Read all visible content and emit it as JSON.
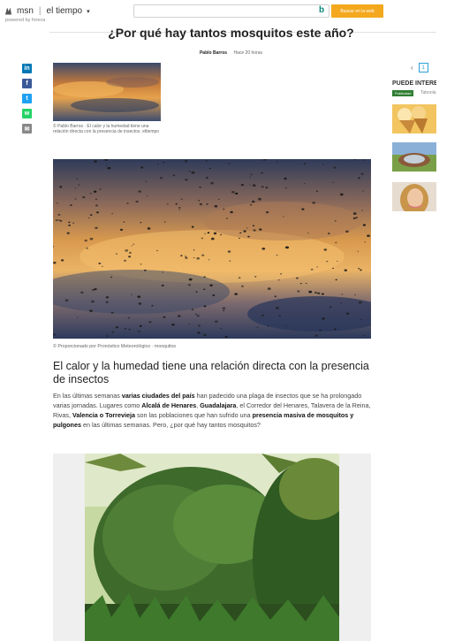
{
  "header": {
    "brand": "msn",
    "section": "el tiempo",
    "powered_by": "powered by foreca",
    "search_placeholder": "",
    "search_button": "Buscar en la web"
  },
  "article": {
    "title": "¿Por qué hay tantos mosquitos este año?",
    "author": "Pablo Barros",
    "time": "Hace 20 horas",
    "hero_caption": "© Pablo Barros · El calor y la humedad tiene una relación directa con la presencia de insectos. eltiempo",
    "main_caption": "© Proporcionado por Pronóstico Meteorológico · mosquitos",
    "subheading": "El calor y la humedad tiene una relación directa con la presencia de insectos",
    "paragraph": [
      {
        "t": "En las últimas semanas ",
        "b": false
      },
      {
        "t": "varias ciudades del país",
        "b": true
      },
      {
        "t": " han padecido una plaga de insectos que se ha prolongado varias jornadas. Lugares como ",
        "b": false
      },
      {
        "t": "Alcalá de Henares",
        "b": true
      },
      {
        "t": ", ",
        "b": false
      },
      {
        "t": "Guadalajara",
        "b": true
      },
      {
        "t": ", el Corredor del Henares, Talavera de la Reina, Rivas, ",
        "b": false
      },
      {
        "t": "Valencia o Torrevieja",
        "b": true
      },
      {
        "t": " son las poblaciones que han sufrido una ",
        "b": false
      },
      {
        "t": "presencia masiva de mosquitos y pulgones",
        "b": true
      },
      {
        "t": " en las últimas semanas. Pero, ¿por qué hay tantos mosquitos?",
        "b": false
      }
    ]
  },
  "share": [
    {
      "icon": "linkedin-icon",
      "glyph": "in",
      "color": "#0077b5"
    },
    {
      "icon": "facebook-icon",
      "glyph": "f",
      "color": "#3b5998"
    },
    {
      "icon": "twitter-icon",
      "glyph": "t",
      "color": "#1da1f2"
    },
    {
      "icon": "whatsapp-icon",
      "glyph": "w",
      "color": "#25d366"
    },
    {
      "icon": "email-icon",
      "glyph": "✉",
      "color": "#888888"
    }
  ],
  "rail": {
    "pager_prev": "‹",
    "pager_page": "1",
    "title": "PUEDE INTERESARTE",
    "badge": "Publicidad",
    "source": "Taboola"
  }
}
